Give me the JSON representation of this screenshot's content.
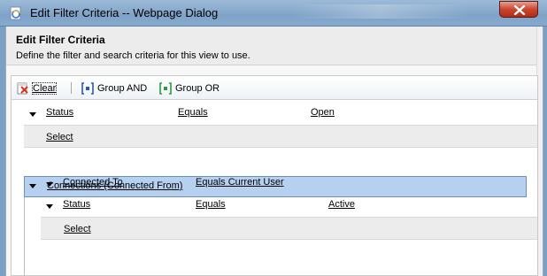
{
  "window": {
    "title": "Edit Filter Criteria -- Webpage Dialog"
  },
  "header": {
    "title": "Edit Filter Criteria",
    "description": "Define the filter and search criteria for this view to use."
  },
  "toolbar": {
    "clear_label": "Clear",
    "group_and_label": "Group AND",
    "group_or_label": "Group OR"
  },
  "conditions": [
    {
      "field": "Status",
      "operator": "Equals",
      "value": "Open"
    }
  ],
  "select_label": "Select",
  "related_group": {
    "title": "Connections (Connected From)",
    "conditions": [
      {
        "field": "Connected To",
        "operator": "Equals Current User",
        "value": ""
      },
      {
        "field": "Status",
        "operator": "Equals",
        "value": "Active"
      }
    ],
    "select_label": "Select"
  },
  "colors": {
    "group_header_bg": "#b6d1f0",
    "group_header_border": "#6d8fbf",
    "close_button": "#c9452e"
  },
  "icons": {
    "window": "ie-page-icon",
    "clear": "clear-filter-icon",
    "group_and": "group-and-icon",
    "group_or": "group-or-icon",
    "close": "close-icon"
  }
}
